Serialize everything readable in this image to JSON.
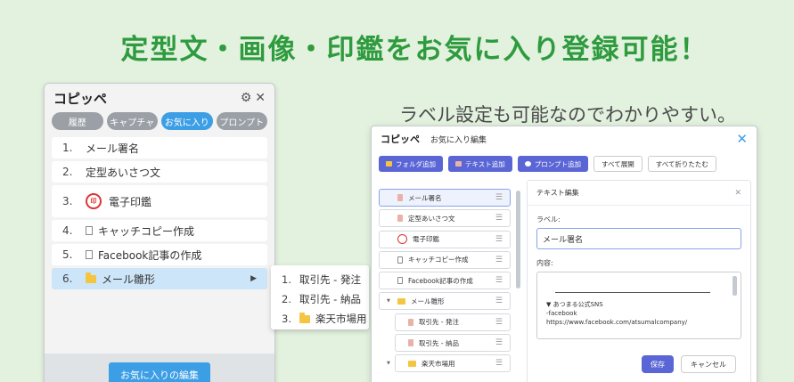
{
  "headline": "定型文・画像・印鑑をお気に入り登録可能！",
  "subline": "ラベル設定も可能なのでわかりやすい。",
  "popup": {
    "title": "コピッペ",
    "icons": [
      "gear-icon",
      "close-icon"
    ],
    "tabs": [
      "履歴",
      "キャプチャ",
      "お気に入り",
      "プロンプト"
    ],
    "active_tab": "お気に入り",
    "items": [
      {
        "num": "1.",
        "label": "メール署名"
      },
      {
        "num": "2.",
        "label": "定型あいさつ文"
      },
      {
        "num": "3.",
        "label": "電子印鑑"
      },
      {
        "num": "4.",
        "label": "キャッチコピー作成"
      },
      {
        "num": "5.",
        "label": "Facebook記事の作成"
      },
      {
        "num": "6.",
        "label": "メール雛形"
      }
    ],
    "footer_button": "お気に入りの編集"
  },
  "flyout": {
    "items": [
      {
        "num": "1.",
        "label": "取引先 - 発注"
      },
      {
        "num": "2.",
        "label": "取引先 - 納品"
      },
      {
        "num": "3.",
        "label": "楽天市場用"
      }
    ]
  },
  "editor": {
    "logo": "コピッペ",
    "title": "お気に入り編集",
    "toolbar": [
      "フォルダ追加",
      "テキスト追加",
      "プロンプト追加",
      "すべて展開",
      "すべて折りたたむ"
    ],
    "tree": [
      "メール署名",
      "定型あいさつ文",
      "電子印鑑",
      "キャッチコピー作成",
      "Facebook記事の作成",
      "メール雛形",
      "取引先 - 発注",
      "取引先 - 納品",
      "楽天市場用"
    ],
    "panel": {
      "title": "テキスト編集",
      "label_caption": "ラベル:",
      "label_value": "メール署名",
      "content_caption": "内容:",
      "content_lines": [
        "▼ あつまる公式SNS",
        "-facebook",
        "https://www.facebook.com/atsumalcompany/"
      ],
      "save": "保存",
      "cancel": "キャンセル"
    }
  },
  "colors": {
    "background": "#e3f1df",
    "headline": "#2e9b3e",
    "accent_blue": "#3c9ee5",
    "button_indigo": "#5b66d6"
  }
}
